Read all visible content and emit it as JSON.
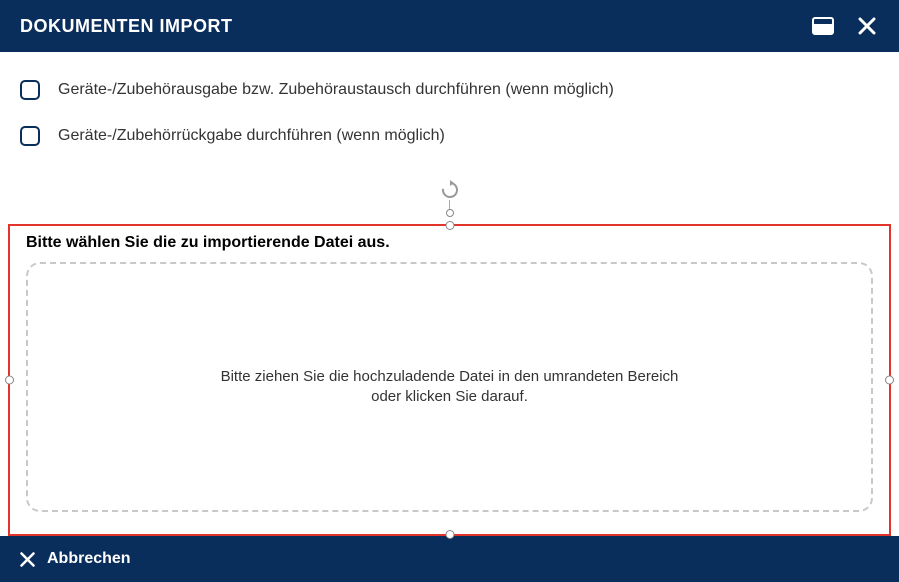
{
  "header": {
    "title": "DOKUMENTEN IMPORT"
  },
  "checkboxes": [
    {
      "label": "Geräte-/Zubehörausgabe bzw. Zubehöraustausch durchführen (wenn möglich)"
    },
    {
      "label": "Geräte-/Zubehörrückgabe durchführen (wenn möglich)"
    }
  ],
  "importPanel": {
    "title": "Bitte wählen Sie die zu importierende Datei aus.",
    "dropzoneText": "Bitte ziehen Sie die hochzuladende Datei in den umrandeten Bereich oder klicken Sie darauf."
  },
  "footer": {
    "cancelLabel": "Abbrechen"
  },
  "colors": {
    "primary": "#0a2e5c",
    "panelBorder": "#e2342b"
  }
}
